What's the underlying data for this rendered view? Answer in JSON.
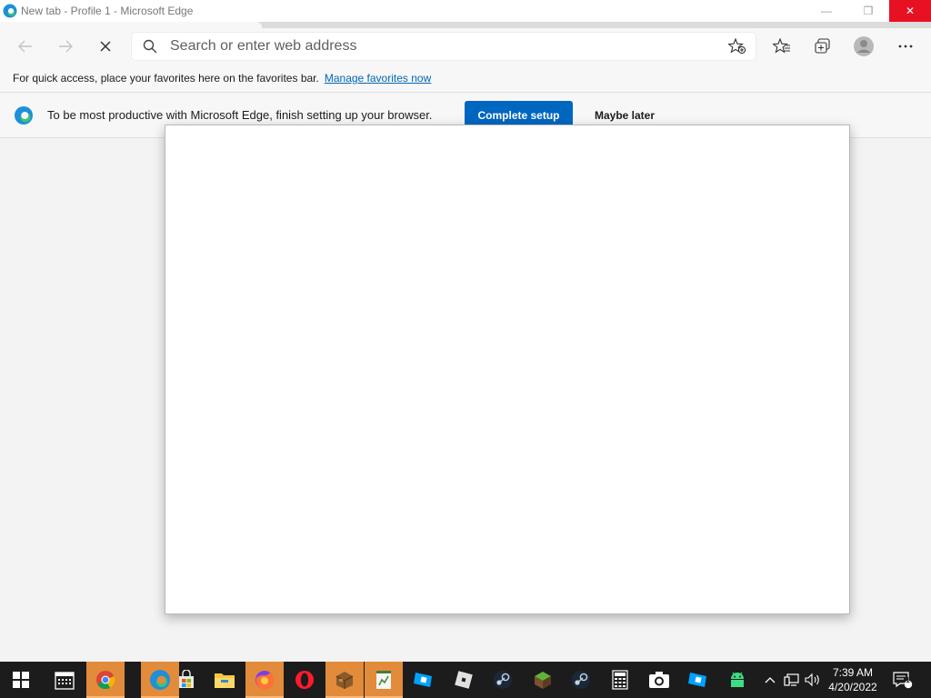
{
  "window": {
    "title": "New tab - Profile 1 - Microsoft Edge",
    "controls": {
      "minimize": "—",
      "restore": "❐",
      "close": "✕"
    }
  },
  "toolbar": {
    "address_placeholder": "Search or enter web address",
    "icons": [
      "back-arrow-icon",
      "forward-arrow-icon",
      "stop-loading-icon",
      "search-icon",
      "add-favorite-star-icon",
      "favorites-icon",
      "collections-icon",
      "profile-avatar-icon",
      "more-menu-icon"
    ]
  },
  "favorites_bar": {
    "message": "For quick access, place your favorites here on the favorites bar.",
    "link": "Manage favorites now"
  },
  "setup_bar": {
    "message": "To be most productive with Microsoft Edge, finish setting up your browser.",
    "primary_button": "Complete setup",
    "secondary_button": "Maybe later"
  },
  "taskbar": {
    "apps": [
      "windows-start-icon",
      "calendar-icon",
      "chrome-icon",
      "edge-icon",
      "store-icon",
      "file-explorer-icon",
      "firefox-icon",
      "opera-icon",
      "crate-icon",
      "notepad-chart-icon",
      "roblox-studio-icon",
      "roblox-icon",
      "steam-icon",
      "minecraft-icon",
      "steam-icon-2",
      "calculator-icon",
      "camera-icon",
      "roblox-studio-icon-2",
      "android-icon"
    ],
    "time": "7:39 AM",
    "date": "4/20/2022",
    "notification_count": "1"
  },
  "colors": {
    "accent": "#0067c0",
    "close_button": "#e81123",
    "taskbar": "#1c1c1c",
    "running_app": "#e28b3a"
  }
}
